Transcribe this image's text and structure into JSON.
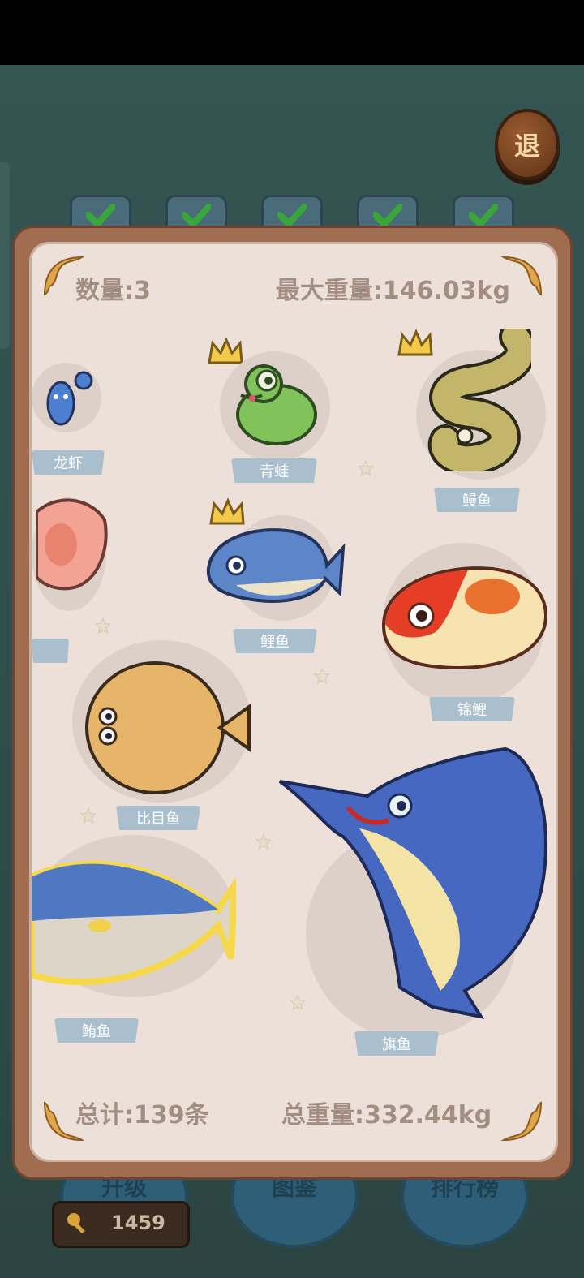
{
  "hud": {
    "exit_label": "退",
    "coins": "1459"
  },
  "bottom_nav": [
    {
      "label": "升级"
    },
    {
      "label": "图鉴"
    },
    {
      "label": "排行榜"
    }
  ],
  "panel": {
    "count_label": "数量:3",
    "max_weight_label": "最大重量:146.03kg",
    "total_label": "总计:139条",
    "total_weight_label": "总重量:332.44kg"
  },
  "fish": [
    {
      "name": "龙虾",
      "icon": "lobster-icon",
      "crown": false
    },
    {
      "name": "青蛙",
      "icon": "frog-icon",
      "crown": true
    },
    {
      "name": "鳗鱼",
      "icon": "eel-icon",
      "crown": true
    },
    {
      "name": "",
      "icon": "pink-fish-icon",
      "crown": false
    },
    {
      "name": "鲤鱼",
      "icon": "carp-icon",
      "crown": true
    },
    {
      "name": "锦鲤",
      "icon": "koi-icon",
      "crown": false
    },
    {
      "name": "比目鱼",
      "icon": "flounder-icon",
      "crown": false
    },
    {
      "name": "鲔鱼",
      "icon": "tuna-icon",
      "crown": false
    },
    {
      "name": "旗鱼",
      "icon": "marlin-icon",
      "crown": false
    }
  ],
  "colors": {
    "panel_bg": "#ede0d8",
    "frame": "#a06d51",
    "label_bg": "#a9bfcd",
    "header_text": "#a38e83"
  }
}
